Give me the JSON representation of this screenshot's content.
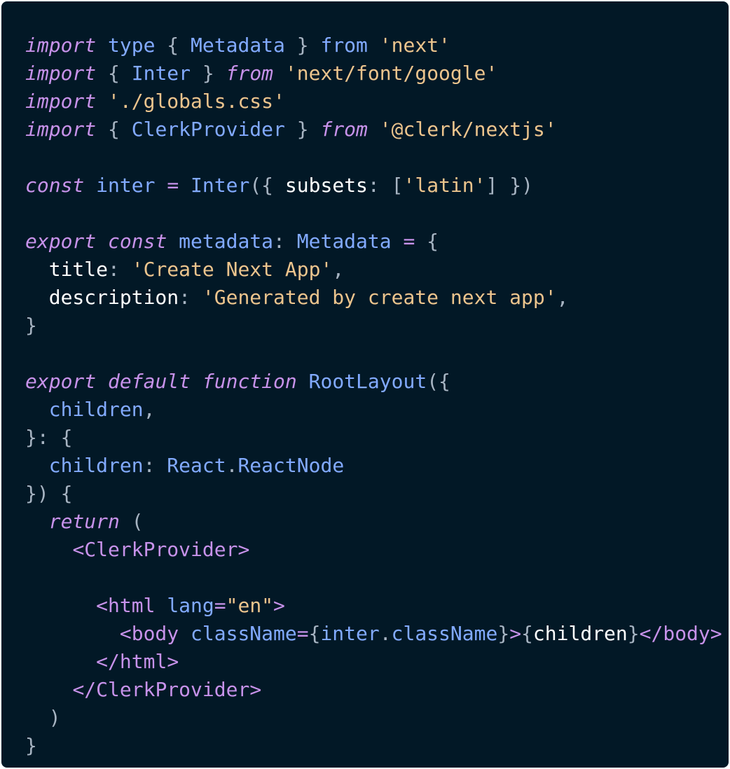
{
  "theme": {
    "background": "#021826",
    "page_background": "#ffffff"
  },
  "code": {
    "language": "tsx",
    "lines": [
      [
        [
          "import",
          "kw"
        ],
        [
          " ",
          "p"
        ],
        [
          "type",
          "type"
        ],
        [
          " { ",
          "p"
        ],
        [
          "Metadata",
          "ident"
        ],
        [
          " } ",
          "p"
        ],
        [
          "from",
          "type"
        ],
        [
          " ",
          "p"
        ],
        [
          "'next'",
          "str"
        ]
      ],
      [
        [
          "import",
          "kw"
        ],
        [
          " { ",
          "p"
        ],
        [
          "Inter",
          "ident"
        ],
        [
          " } ",
          "p"
        ],
        [
          "from",
          "kw"
        ],
        [
          " ",
          "p"
        ],
        [
          "'next/font/google'",
          "str"
        ]
      ],
      [
        [
          "import",
          "kw"
        ],
        [
          " ",
          "p"
        ],
        [
          "'./globals.css'",
          "str"
        ]
      ],
      [
        [
          "import",
          "kw"
        ],
        [
          " { ",
          "p"
        ],
        [
          "ClerkProvider",
          "ident"
        ],
        [
          " } ",
          "p"
        ],
        [
          "from",
          "kw"
        ],
        [
          " ",
          "p"
        ],
        [
          "'@clerk/nextjs'",
          "str"
        ]
      ],
      [],
      [
        [
          "const",
          "kw"
        ],
        [
          " ",
          "p"
        ],
        [
          "inter",
          "ident"
        ],
        [
          " ",
          "p"
        ],
        [
          "=",
          "op"
        ],
        [
          " ",
          "p"
        ],
        [
          "Inter",
          "ident"
        ],
        [
          "({ ",
          "p"
        ],
        [
          "subsets",
          "prop"
        ],
        [
          ": [",
          "p"
        ],
        [
          "'latin'",
          "str"
        ],
        [
          "] })",
          "p"
        ]
      ],
      [],
      [
        [
          "export",
          "kw"
        ],
        [
          " ",
          "p"
        ],
        [
          "const",
          "kw"
        ],
        [
          " ",
          "p"
        ],
        [
          "metadata",
          "ident"
        ],
        [
          ": ",
          "p"
        ],
        [
          "Metadata",
          "ident"
        ],
        [
          " ",
          "p"
        ],
        [
          "=",
          "op"
        ],
        [
          " {",
          "p"
        ]
      ],
      [
        [
          "  ",
          "p"
        ],
        [
          "title",
          "prop"
        ],
        [
          ": ",
          "p"
        ],
        [
          "'Create Next App'",
          "str"
        ],
        [
          ",",
          "p"
        ]
      ],
      [
        [
          "  ",
          "p"
        ],
        [
          "description",
          "prop"
        ],
        [
          ": ",
          "p"
        ],
        [
          "'Generated by create next app'",
          "str"
        ],
        [
          ",",
          "p"
        ]
      ],
      [
        [
          "}",
          "p"
        ]
      ],
      [],
      [
        [
          "export",
          "kw"
        ],
        [
          " ",
          "p"
        ],
        [
          "default",
          "kw"
        ],
        [
          " ",
          "p"
        ],
        [
          "function",
          "kw"
        ],
        [
          " ",
          "p"
        ],
        [
          "RootLayout",
          "ident"
        ],
        [
          "({",
          "p"
        ]
      ],
      [
        [
          "  ",
          "p"
        ],
        [
          "children",
          "ident"
        ],
        [
          ",",
          "p"
        ]
      ],
      [
        [
          "}: {",
          "p"
        ]
      ],
      [
        [
          "  ",
          "p"
        ],
        [
          "children",
          "ident"
        ],
        [
          ": ",
          "p"
        ],
        [
          "React",
          "ident"
        ],
        [
          ".",
          "p"
        ],
        [
          "ReactNode",
          "ident"
        ]
      ],
      [
        [
          "}) {",
          "p"
        ]
      ],
      [
        [
          "  ",
          "p"
        ],
        [
          "return",
          "kw"
        ],
        [
          " (",
          "p"
        ]
      ],
      [
        [
          "    ",
          "p"
        ],
        [
          "<",
          "tag"
        ],
        [
          "ClerkProvider",
          "tag"
        ],
        [
          ">",
          "tag"
        ]
      ],
      [],
      [
        [
          "      ",
          "p"
        ],
        [
          "<",
          "tag"
        ],
        [
          "html",
          "tag"
        ],
        [
          " ",
          "p"
        ],
        [
          "lang",
          "ident"
        ],
        [
          "=",
          "tag"
        ],
        [
          "\"en\"",
          "str"
        ],
        [
          ">",
          "tag"
        ]
      ],
      [
        [
          "        ",
          "p"
        ],
        [
          "<",
          "tag"
        ],
        [
          "body",
          "tag"
        ],
        [
          " ",
          "p"
        ],
        [
          "className",
          "ident"
        ],
        [
          "=",
          "tag"
        ],
        [
          "{",
          "p"
        ],
        [
          "inter",
          "ident"
        ],
        [
          ".",
          "p"
        ],
        [
          "className",
          "ident"
        ],
        [
          "}",
          "p"
        ],
        [
          ">",
          "tag"
        ],
        [
          "{",
          "p"
        ],
        [
          "children",
          "prop"
        ],
        [
          "}",
          "p"
        ],
        [
          "</",
          "tag"
        ],
        [
          "body",
          "tag"
        ],
        [
          ">",
          "tag"
        ]
      ],
      [
        [
          "      ",
          "p"
        ],
        [
          "</",
          "tag"
        ],
        [
          "html",
          "tag"
        ],
        [
          ">",
          "tag"
        ]
      ],
      [
        [
          "    ",
          "p"
        ],
        [
          "</",
          "tag"
        ],
        [
          "ClerkProvider",
          "tag"
        ],
        [
          ">",
          "tag"
        ]
      ],
      [
        [
          "  )",
          "p"
        ]
      ],
      [
        [
          "}",
          "p"
        ]
      ]
    ]
  },
  "token_colors": {
    "kw": {
      "color": "#c792ea",
      "italic": true
    },
    "type": {
      "color": "#82aaff",
      "italic": false
    },
    "ident": {
      "color": "#82aaff",
      "italic": false
    },
    "str": {
      "color": "#ecc48d",
      "italic": false
    },
    "prop": {
      "color": "#ffffff",
      "italic": false
    },
    "op": {
      "color": "#c792ea",
      "italic": false
    },
    "tag": {
      "color": "#c792ea",
      "italic": false
    },
    "p": {
      "color": "#a7b4c2",
      "italic": false
    }
  }
}
